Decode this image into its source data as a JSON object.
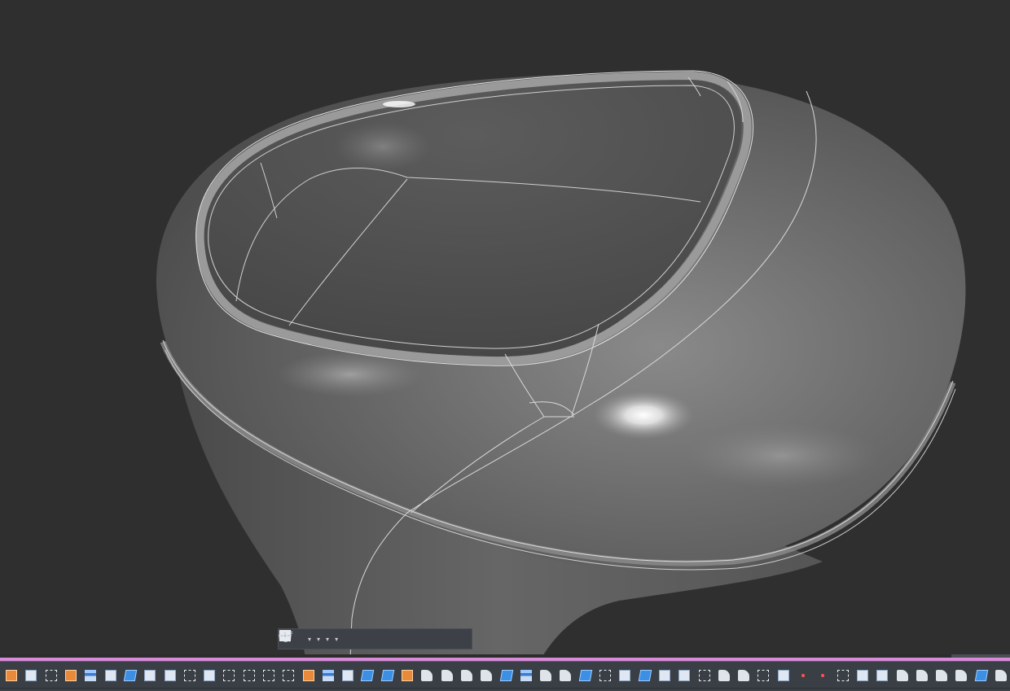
{
  "viewport": {
    "background": "#2f2f2f",
    "model": "3d-surface-bowl",
    "model_color": "#6d6d6d",
    "edge_color": "#d8d8d8"
  },
  "nav_toolbar": {
    "buttons": [
      {
        "name": "orbit-icon",
        "dropdown": true
      },
      {
        "name": "view-cube-icon",
        "dropdown": false
      },
      {
        "name": "pan-hand-icon",
        "dropdown": false
      },
      {
        "name": "zoom-icon",
        "dropdown": false
      },
      {
        "name": "zoom-extents-icon",
        "dropdown": true
      },
      {
        "name": "display-monitor-icon",
        "dropdown": true
      },
      {
        "name": "grid-icon",
        "dropdown": true
      },
      {
        "name": "viewports-icon",
        "dropdown": true
      }
    ],
    "dropdown_glyph": "▾"
  },
  "bottom_accent_color": "#d98ad9",
  "ribbon": {
    "background": "#3a3f46",
    "tools": [
      "orange",
      "sheet",
      "dash",
      "orange",
      "stack",
      "sheet",
      "blue",
      "sheet",
      "sheet",
      "dash",
      "sheet",
      "dash",
      "dash",
      "dash",
      "dash",
      "orange",
      "stack",
      "sheet",
      "blue",
      "blue",
      "orange",
      "round",
      "round",
      "round",
      "round",
      "blue",
      "stack",
      "round",
      "round",
      "blue",
      "dash",
      "sheet",
      "blue",
      "sheet",
      "sheet",
      "dash",
      "round",
      "round",
      "dash",
      "sheet",
      "dot",
      "dot",
      "dash",
      "sheet",
      "sheet",
      "round",
      "round",
      "round",
      "round",
      "blue",
      "round"
    ]
  }
}
